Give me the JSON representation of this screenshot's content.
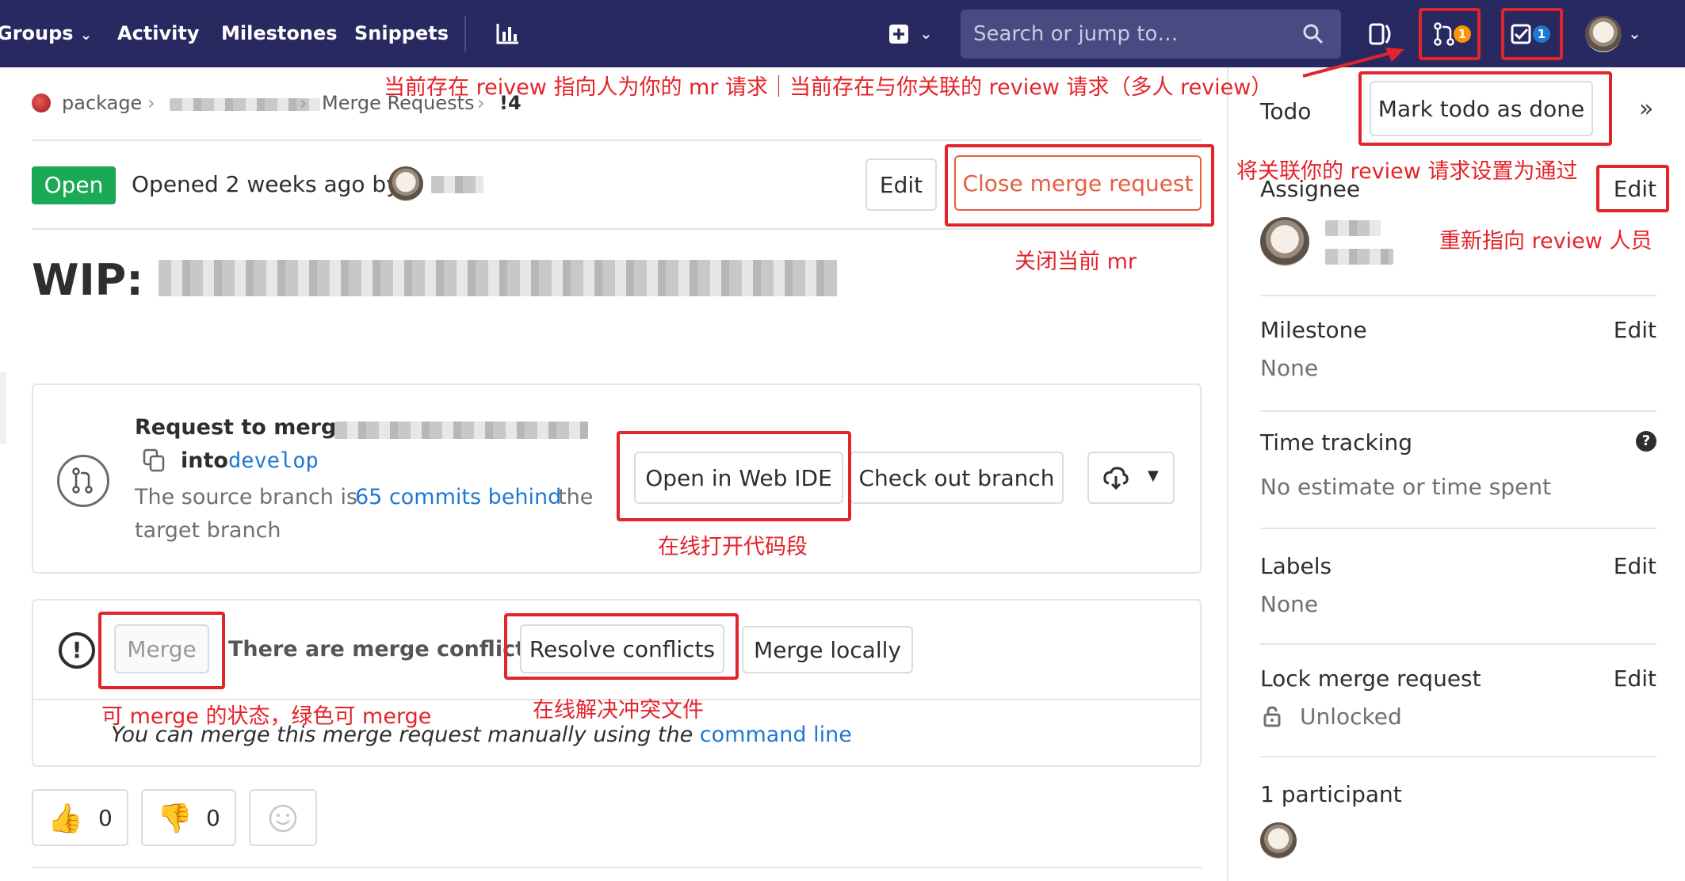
{
  "nav": {
    "groups": "Groups",
    "activity": "Activity",
    "milestones": "Milestones",
    "snippets": "Snippets",
    "chart_icon": "chart-icon",
    "plus_icon": "plus-square-icon",
    "search_placeholder": "Search or jump to…",
    "merge_requests_count": "1",
    "todos_count": "1"
  },
  "breadcrumb": {
    "project": "package",
    "section": "Merge Requests",
    "current": "!4"
  },
  "header": {
    "status": "Open",
    "opened_text": "Opened 2 weeks ago by",
    "edit": "Edit",
    "close": "Close merge request"
  },
  "title": {
    "prefix": "WIP:"
  },
  "widget": {
    "request_to_merge": "Request to merge",
    "into": "into",
    "target_branch": "develop",
    "source_branch_prefix": "The source branch is",
    "commits_behind": "65 commits behind",
    "source_branch_suffix": "the",
    "target_branch_word": "target branch",
    "open_web_ide": "Open in Web IDE",
    "check_out_branch": "Check out branch",
    "merge": "Merge",
    "conflicts_text": "There are merge conflicts",
    "resolve_conflicts": "Resolve conflicts",
    "merge_locally": "Merge locally",
    "manual_text": "You can merge this merge request manually using the",
    "command_line": "command line"
  },
  "awards": {
    "thumbs_up": "0",
    "thumbs_down": "0"
  },
  "sidebar": {
    "todo_label": "Todo",
    "mark_todo_done": "Mark todo as done",
    "assignee": "Assignee",
    "assignee_edit": "Edit",
    "milestone": "Milestone",
    "milestone_edit": "Edit",
    "milestone_value": "None",
    "time_tracking": "Time tracking",
    "time_value": "No estimate or time spent",
    "labels": "Labels",
    "labels_edit": "Edit",
    "labels_value": "None",
    "lock": "Lock merge request",
    "lock_edit": "Edit",
    "lock_value": "Unlocked",
    "participants": "1 participant"
  },
  "annotations": {
    "top": "当前存在 reivew 指向人为你的 mr 请求｜当前存在与你关联的 review 请求（多人 review）",
    "approve": "将关联你的 review 请求设置为通过",
    "reassign": "重新指向 review 人员",
    "close_mr": "关闭当前 mr",
    "web_ide": "在线打开代码段",
    "merge_state": "可 merge 的状态，绿色可 merge",
    "resolve": "在线解决冲突文件"
  },
  "colors": {
    "navbar": "#292961",
    "annotation_red": "#e4232a",
    "open_green": "#1aaa55",
    "close_orange": "#e75e40",
    "link_blue": "#1f78d1"
  }
}
